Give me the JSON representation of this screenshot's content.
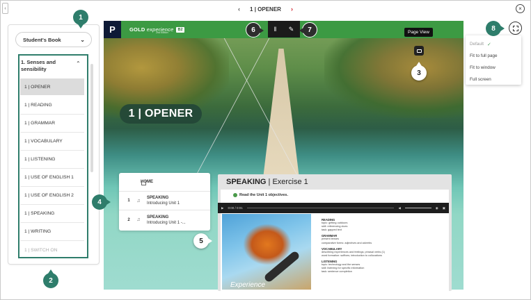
{
  "topnav": {
    "prev": "‹",
    "title": "1 | OPENER",
    "next": "›",
    "collapse": "‹",
    "close": "×"
  },
  "sidebar": {
    "book_select": "Student's Book",
    "unit_title": "1. Senses and sensibility",
    "lessons": [
      {
        "label": "1 | OPENER"
      },
      {
        "label": "1 | READING"
      },
      {
        "label": "1 | GRAMMAR"
      },
      {
        "label": "1 | VOCABULARY"
      },
      {
        "label": "1 | LISTENING"
      },
      {
        "label": "1 | USE OF ENGLISH 1"
      },
      {
        "label": "1 | USE OF ENGLISH 2"
      },
      {
        "label": "1 | SPEAKING"
      },
      {
        "label": "1 | WRITING"
      },
      {
        "label": "1 | SWITCH ON"
      }
    ]
  },
  "page": {
    "logo": "P",
    "brand_gold": "GOLD",
    "brand_exp": "experience",
    "brand_sub": "2nd Edition",
    "level": "B2",
    "opener_title": "1 | OPENER",
    "tooltip": "Page View"
  },
  "view_menu": {
    "options": [
      "Default",
      "Fit to full page",
      "Fit to window",
      "Full screen"
    ],
    "check": "✓"
  },
  "nav_card": {
    "home": "HOME",
    "rows": [
      {
        "num": "1",
        "title": "SPEAKING",
        "subtitle": "Introducing Unit 1"
      },
      {
        "num": "2",
        "title": "SPEAKING",
        "subtitle": "Introducing Unit 1 -..."
      }
    ]
  },
  "exercise": {
    "title_bold": "SPEAKING",
    "title_light": " | Exercise 1",
    "instruction": "Read the Unit 1 objectives.",
    "time": "0:00 / 0:01",
    "photo_caption": "Experience",
    "sections": [
      {
        "head": "READING",
        "lines": [
          "topic: getting outdoors",
          "skill: referencing clues",
          "task: gapped text"
        ]
      },
      {
        "head": "GRAMMAR",
        "lines": [
          "present tenses",
          "comparative forms: adjectives and adverbs"
        ]
      },
      {
        "head": "VOCABULARY",
        "lines": [
          "describing experiences and feelings; phrasal verbs (1)",
          "word formation: suffixes; introduction to collocations"
        ]
      },
      {
        "head": "LISTENING",
        "lines": [
          "topic: technology and the senses",
          "skill: listening for specific information",
          "task: sentence completion"
        ]
      }
    ]
  },
  "markers": [
    "1",
    "2",
    "3",
    "4",
    "5",
    "6",
    "7",
    "8"
  ]
}
